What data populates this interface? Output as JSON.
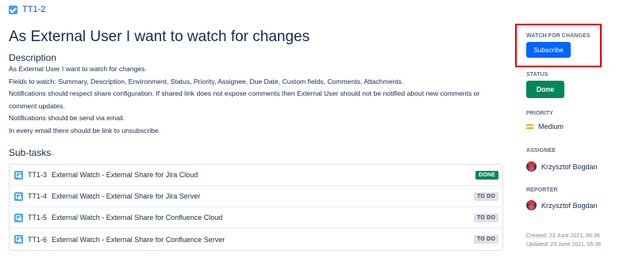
{
  "breadcrumb": {
    "issue_key": "TT1-2"
  },
  "issue": {
    "title": "As External User I want to watch for changes",
    "description_label": "Description",
    "description_lines": [
      "As External User I want to watch for changes.",
      "Fields to watch: Summary, Description, Environment, Status, Priority, Assignee, Due Date, Custom fields, Comments, Attachments.",
      "Notifications should respect share configuration. If shared link does not expose comments then External User should not be notified about new comments or comment updates.",
      "Notifications should be send via email.",
      "In every email there should be link to unsubscribe."
    ]
  },
  "subtasks": {
    "label": "Sub-tasks",
    "items": [
      {
        "key": "TT1-3",
        "summary": "External Watch - External Share for Jira Cloud",
        "status": "DONE"
      },
      {
        "key": "TT1-4",
        "summary": "External Watch - External Share for Jira Server",
        "status": "TO DO"
      },
      {
        "key": "TT1-5",
        "summary": "External Watch - External Share for Confluence Cloud",
        "status": "TO DO"
      },
      {
        "key": "TT1-6",
        "summary": "External Watch - External Share for Confluence Server",
        "status": "TO DO"
      }
    ]
  },
  "sidebar": {
    "watch_label": "WATCH FOR CHANGES",
    "subscribe_label": "Subscribe",
    "status_label": "STATUS",
    "status_value": "Done",
    "priority_label": "PRIORITY",
    "priority_value": "Medium",
    "assignee_label": "ASSIGNEE",
    "assignee_name": "Krzysztof Bogdan",
    "reporter_label": "REPORTER",
    "reporter_name": "Krzysztof Bogdan",
    "created": "Created: 23 June 2021, 05:36",
    "updated": "Updated: 23 June 2021, 05:36"
  },
  "colors": {
    "accent": "#0065ff",
    "done": "#00875a",
    "highlight_box": "#e00000",
    "priority_medium": "#ffab00"
  }
}
